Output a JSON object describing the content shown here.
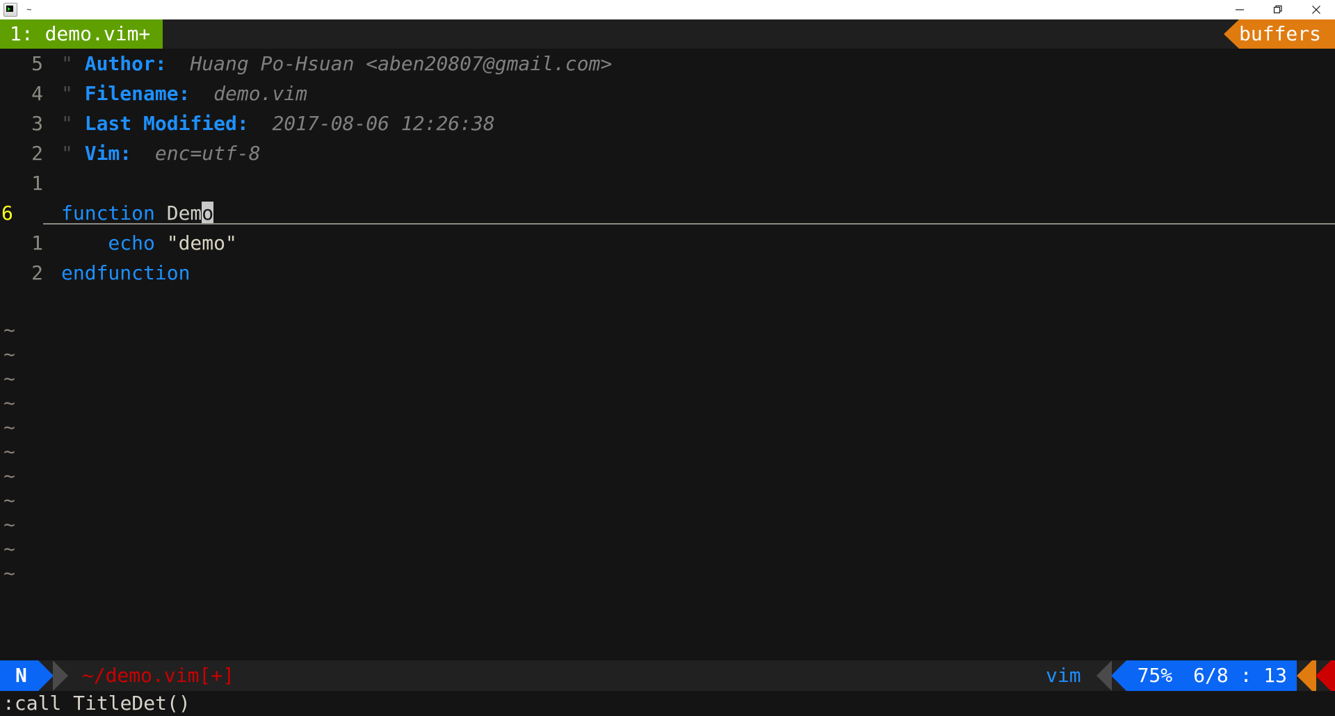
{
  "window": {
    "title": "~",
    "icon": "terminal-icon",
    "controls": {
      "minimize": "minimize-icon",
      "maximize": "maximize-icon",
      "close": "close-icon"
    }
  },
  "tabline": {
    "active_tab": "1: demo.vim+",
    "right_label": "buffers",
    "colors": {
      "tab_bg": "#5fa000",
      "buffers_bg": "#e07b10",
      "bar_bg": "#1f1f1f"
    }
  },
  "editor": {
    "background": "#141414",
    "lines": [
      {
        "number": "5",
        "current": false,
        "segments": [
          {
            "class": "cmt",
            "text": "\" "
          },
          {
            "class": "key",
            "text": "Author:"
          },
          {
            "class": "val",
            "text": "  Huang Po-Hsuan <aben20807@gmail.com>"
          }
        ]
      },
      {
        "number": "4",
        "current": false,
        "segments": [
          {
            "class": "cmt",
            "text": "\" "
          },
          {
            "class": "key",
            "text": "Filename:"
          },
          {
            "class": "val",
            "text": "  demo.vim"
          }
        ]
      },
      {
        "number": "3",
        "current": false,
        "segments": [
          {
            "class": "cmt",
            "text": "\" "
          },
          {
            "class": "key",
            "text": "Last Modified:"
          },
          {
            "class": "val",
            "text": "  2017-08-06 12:26:38"
          }
        ]
      },
      {
        "number": "2",
        "current": false,
        "segments": [
          {
            "class": "cmt",
            "text": "\" "
          },
          {
            "class": "key",
            "text": "Vim:"
          },
          {
            "class": "val",
            "text": "  enc=utf-8"
          }
        ]
      },
      {
        "number": "1",
        "current": false,
        "segments": []
      },
      {
        "number": "6",
        "current": true,
        "segments": [
          {
            "class": "kw",
            "text": "function"
          },
          {
            "class": "ident",
            "text": " Dem"
          },
          {
            "class": "cursorblk",
            "text": "o"
          }
        ]
      },
      {
        "number": "1",
        "current": false,
        "segments": [
          {
            "class": "kw",
            "text": "    echo"
          },
          {
            "class": "str",
            "text": " \"demo\""
          }
        ]
      },
      {
        "number": "2",
        "current": false,
        "segments": [
          {
            "class": "kw",
            "text": "endfunction"
          }
        ]
      }
    ],
    "filler_rows": [
      "~",
      "~",
      "~",
      "~",
      "~",
      "~",
      "~",
      "~",
      "~",
      "~",
      "~"
    ],
    "cursor_char": "o"
  },
  "statusline": {
    "mode": "N",
    "filename": "~/demo.vim[+]",
    "filetype": "vim",
    "percent": "75%",
    "position": "6/8 : 13",
    "colors": {
      "mode_bg": "#0a66f5",
      "filename_fg": "#cc0000",
      "accent_orange": "#e07b10",
      "accent_red": "#cc0000"
    }
  },
  "cmdline": {
    "text": ":call TitleDet()"
  }
}
